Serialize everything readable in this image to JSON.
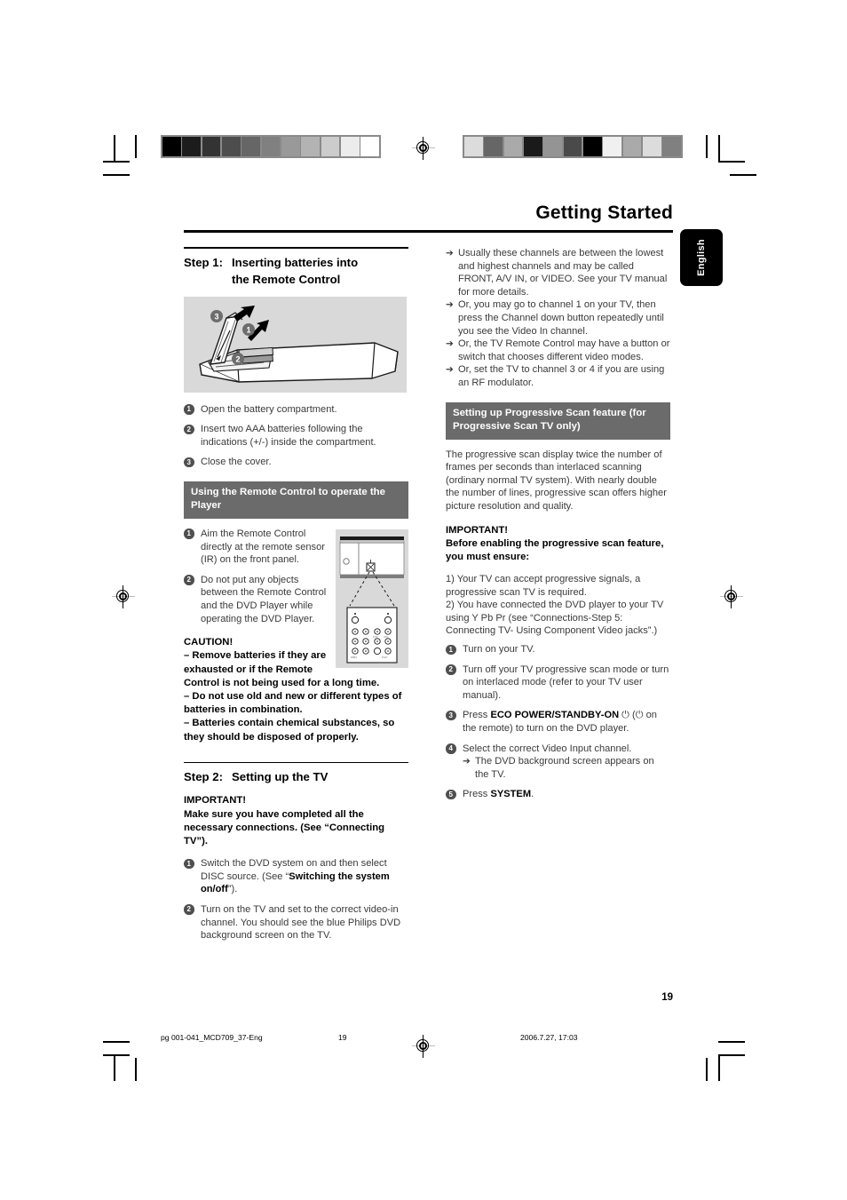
{
  "header": {
    "title": "Getting Started",
    "language_tab": "English"
  },
  "calibration": {
    "left_strip": [
      "#000000",
      "#1c1c1c",
      "#333333",
      "#4d4d4d",
      "#666666",
      "#808080",
      "#999999",
      "#b3b3b3",
      "#cccccc",
      "#ececec",
      "#ffffff"
    ],
    "right_strip": [
      "#dcdcdc",
      "#666666",
      "#aaaaaa",
      "#1a1a1a",
      "#949494",
      "#4a4a4a",
      "#000000",
      "#f0f0f0",
      "#aaaaaa",
      "#dcdcdc",
      "#808080"
    ],
    "strip_border": "#8a8a8a"
  },
  "left_column": {
    "step1": {
      "label": "Step 1:",
      "text": "Inserting batteries into\nthe Remote Control"
    },
    "illustration_remote": {
      "name": "remote-control-battery-compartment-illustration",
      "callouts": [
        "3",
        "1",
        "2"
      ]
    },
    "battery_steps": [
      {
        "num": "1",
        "text": "Open the battery compartment."
      },
      {
        "num": "2",
        "text": "Insert two AAA batteries following the indications (+/-) inside the compartment."
      },
      {
        "num": "3",
        "text": "Close the cover."
      }
    ],
    "remote_use_header": "Using the Remote Control to operate the Player",
    "remote_use_steps": [
      {
        "num": "1",
        "text": "Aim the Remote Control directly at the remote sensor (IR) on the front panel."
      },
      {
        "num": "2",
        "text": "Do not put any objects between the Remote Control and the DVD Player while operating the DVD Player."
      }
    ],
    "caution": {
      "heading": "CAUTION!",
      "items": [
        "–  Remove batteries if they are exhausted or if the Remote Control is not being used for a long time.",
        "–  Do not use old and new or different types of batteries in combination.",
        "–  Batteries contain chemical substances, so they should be disposed of properly."
      ]
    },
    "step2": {
      "label": "Step 2:",
      "text": "Setting up the TV"
    },
    "important": {
      "heading": "IMPORTANT!",
      "body": "Make sure you have completed all the necessary connections. (See “Connecting TV”)."
    },
    "tv_steps": [
      {
        "num": "1",
        "pre": "Switch the DVD system on and then select DISC source. (See “",
        "bold": "Switching the system on/off",
        "post": "”)."
      },
      {
        "num": "2",
        "text": "Turn on the TV and set to the correct video-in channel. You should see the blue Philips DVD background screen on the TV."
      }
    ]
  },
  "right_column": {
    "arrow_notes": [
      "Usually these channels are between the lowest and highest channels and may be called FRONT, A/V IN, or VIDEO. See your TV manual for more details.",
      "Or, you may go to channel 1 on your TV, then press the Channel down button repeatedly until you see the Video In channel.",
      "Or, the TV Remote Control may have a button or switch that chooses different video modes.",
      "Or, set the TV to channel 3 or 4 if you are using an RF modulator."
    ],
    "progressive_header": "Setting up Progressive Scan feature (for Progressive Scan TV only)",
    "progressive_body": "The progressive scan display twice the number of frames per seconds than interlaced scanning (ordinary normal TV system). With nearly double the number of lines, progressive scan offers higher picture resolution and quality.",
    "important": {
      "heading": "IMPORTANT!",
      "body": "Before enabling the progressive scan feature, you must ensure:"
    },
    "requirements": [
      "1) Your TV can accept progressive signals, a progressive scan TV is required.",
      "2) You have connected the DVD player to your TV using Y Pb Pr (see “Connections-Step 5: Connecting TV- Using Component Video jacks”.)"
    ],
    "progressive_steps": [
      {
        "num": "1",
        "text": "Turn on your TV."
      },
      {
        "num": "2",
        "text": "Turn off your TV progressive scan mode or turn on interlaced mode (refer to your TV user manual)."
      },
      {
        "num": "3",
        "pre": "Press ",
        "bold": "ECO POWER/STANDBY-ON",
        "post": " ⏻ (⏻ on the remote) to turn on the DVD player."
      },
      {
        "num": "4",
        "text": "Select the correct Video Input channel.",
        "arrow": "The DVD background screen appears on the TV."
      },
      {
        "num": "5",
        "pre": "Press ",
        "bold": "SYSTEM",
        "post": "."
      }
    ]
  },
  "footer": {
    "page_number": "19",
    "file_name": "pg 001-041_MCD709_37-Eng",
    "page_ref": "19",
    "timestamp": "2006.7.27, 17:03"
  }
}
